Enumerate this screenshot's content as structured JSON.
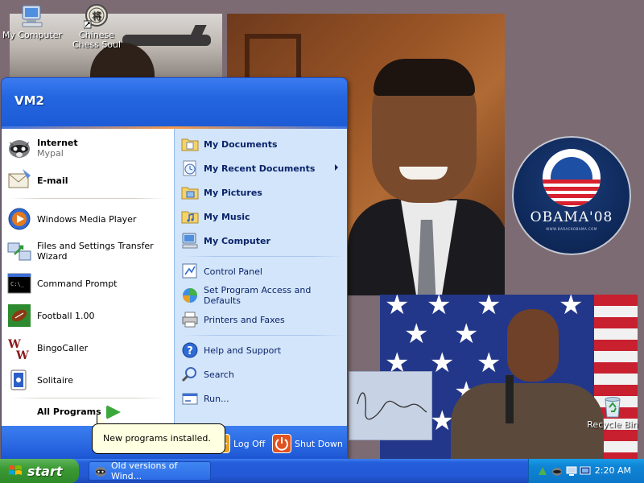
{
  "desktop": {
    "icons": [
      {
        "label": "My Computer"
      },
      {
        "label": "Chinese Chess Soul"
      },
      {
        "label": "Recycle Bin"
      }
    ],
    "logo": {
      "text": "OBAMA'08",
      "url": "WWW.BARACKOBAMA.COM"
    }
  },
  "start_menu": {
    "user_name": "VM2",
    "pinned": [
      {
        "title": "Internet",
        "subtitle": "Mypal",
        "icon": "mypal-raccoon-icon"
      },
      {
        "title": "E-mail",
        "icon": "email-envelope-icon"
      }
    ],
    "recent": [
      {
        "label": "Windows Media Player",
        "icon": "media-player-icon"
      },
      {
        "label": "Files and Settings Transfer Wizard",
        "icon": "transfer-wizard-icon"
      },
      {
        "label": "Command Prompt",
        "icon": "command-prompt-icon"
      },
      {
        "label": "Football 1.00",
        "icon": "football-icon"
      },
      {
        "label": "BingoCaller",
        "icon": "bingo-icon"
      },
      {
        "label": "Solitaire",
        "icon": "solitaire-icon"
      }
    ],
    "all_programs": "All Programs",
    "places": [
      {
        "label": "My Documents",
        "icon": "folder-documents-icon"
      },
      {
        "label": "My Recent Documents",
        "icon": "recent-documents-icon"
      },
      {
        "label": "My Pictures",
        "icon": "folder-pictures-icon"
      },
      {
        "label": "My Music",
        "icon": "folder-music-icon"
      },
      {
        "label": "My Computer",
        "icon": "computer-icon"
      }
    ],
    "system": [
      {
        "label": "Control Panel",
        "icon": "control-panel-icon"
      },
      {
        "label": "Set Program Access and Defaults",
        "icon": "program-defaults-icon"
      },
      {
        "label": "Printers and Faxes",
        "icon": "printer-icon"
      }
    ],
    "help": [
      {
        "label": "Help and Support",
        "icon": "help-icon"
      },
      {
        "label": "Search",
        "icon": "search-icon"
      },
      {
        "label": "Run...",
        "icon": "run-icon"
      }
    ],
    "log_off": "Log Off",
    "shut_down": "Shut Down"
  },
  "balloon": {
    "text": "New programs installed."
  },
  "taskbar": {
    "start_label": "start",
    "tasks": [
      {
        "label": "Old versions of Wind..."
      }
    ],
    "clock": "2:20 AM"
  }
}
